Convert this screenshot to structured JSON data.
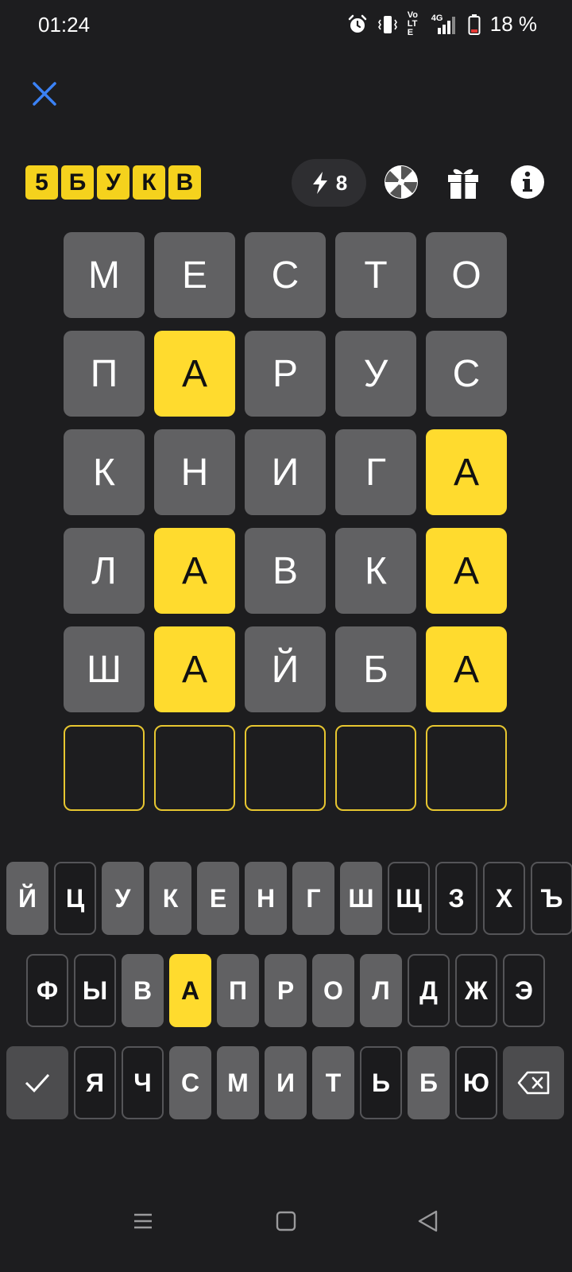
{
  "status_bar": {
    "time": "01:24",
    "battery": "18 %",
    "network": "4G",
    "volte": "Vo LTE",
    "icons": [
      "alarm-icon",
      "vibrate-icon",
      "volte-icon",
      "signal-icon",
      "battery-icon"
    ]
  },
  "header": {
    "logo_letters": [
      "5",
      "Б",
      "У",
      "К",
      "В"
    ],
    "energy_count": "8",
    "icons": [
      "close-icon",
      "bolt-icon",
      "wheel-icon",
      "gift-icon",
      "info-icon"
    ]
  },
  "board": {
    "rows": [
      [
        {
          "letter": "М",
          "state": "absent"
        },
        {
          "letter": "Е",
          "state": "absent"
        },
        {
          "letter": "С",
          "state": "absent"
        },
        {
          "letter": "Т",
          "state": "absent"
        },
        {
          "letter": "О",
          "state": "absent"
        }
      ],
      [
        {
          "letter": "П",
          "state": "absent"
        },
        {
          "letter": "А",
          "state": "present"
        },
        {
          "letter": "Р",
          "state": "absent"
        },
        {
          "letter": "У",
          "state": "absent"
        },
        {
          "letter": "С",
          "state": "absent"
        }
      ],
      [
        {
          "letter": "К",
          "state": "absent"
        },
        {
          "letter": "Н",
          "state": "absent"
        },
        {
          "letter": "И",
          "state": "absent"
        },
        {
          "letter": "Г",
          "state": "absent"
        },
        {
          "letter": "А",
          "state": "present"
        }
      ],
      [
        {
          "letter": "Л",
          "state": "absent"
        },
        {
          "letter": "А",
          "state": "present"
        },
        {
          "letter": "В",
          "state": "absent"
        },
        {
          "letter": "К",
          "state": "absent"
        },
        {
          "letter": "А",
          "state": "present"
        }
      ],
      [
        {
          "letter": "Ш",
          "state": "absent"
        },
        {
          "letter": "А",
          "state": "present"
        },
        {
          "letter": "Й",
          "state": "absent"
        },
        {
          "letter": "Б",
          "state": "absent"
        },
        {
          "letter": "А",
          "state": "present"
        }
      ],
      [
        {
          "letter": "",
          "state": "empty"
        },
        {
          "letter": "",
          "state": "empty"
        },
        {
          "letter": "",
          "state": "empty"
        },
        {
          "letter": "",
          "state": "empty"
        },
        {
          "letter": "",
          "state": "empty"
        }
      ]
    ]
  },
  "keyboard": {
    "row1": [
      {
        "key": "Й",
        "state": "absent"
      },
      {
        "key": "Ц",
        "state": "unused"
      },
      {
        "key": "У",
        "state": "absent"
      },
      {
        "key": "К",
        "state": "absent"
      },
      {
        "key": "Е",
        "state": "absent"
      },
      {
        "key": "Н",
        "state": "absent"
      },
      {
        "key": "Г",
        "state": "absent"
      },
      {
        "key": "Ш",
        "state": "absent"
      },
      {
        "key": "Щ",
        "state": "unused"
      },
      {
        "key": "З",
        "state": "unused"
      },
      {
        "key": "Х",
        "state": "unused"
      },
      {
        "key": "Ъ",
        "state": "unused"
      }
    ],
    "row2": [
      {
        "key": "Ф",
        "state": "unused"
      },
      {
        "key": "Ы",
        "state": "unused"
      },
      {
        "key": "В",
        "state": "absent"
      },
      {
        "key": "А",
        "state": "present"
      },
      {
        "key": "П",
        "state": "absent"
      },
      {
        "key": "Р",
        "state": "absent"
      },
      {
        "key": "О",
        "state": "absent"
      },
      {
        "key": "Л",
        "state": "absent"
      },
      {
        "key": "Д",
        "state": "unused"
      },
      {
        "key": "Ж",
        "state": "unused"
      },
      {
        "key": "Э",
        "state": "unused"
      }
    ],
    "row3": [
      {
        "key": "Я",
        "state": "unused"
      },
      {
        "key": "Ч",
        "state": "unused"
      },
      {
        "key": "С",
        "state": "absent"
      },
      {
        "key": "М",
        "state": "absent"
      },
      {
        "key": "И",
        "state": "absent"
      },
      {
        "key": "Т",
        "state": "absent"
      },
      {
        "key": "Ь",
        "state": "unused"
      },
      {
        "key": "Б",
        "state": "absent"
      },
      {
        "key": "Ю",
        "state": "unused"
      }
    ],
    "enter_icon": "checkmark-icon",
    "backspace_icon": "backspace-icon"
  },
  "nav_bar": {
    "icons": [
      "recents-icon",
      "home-icon",
      "back-icon"
    ]
  },
  "colors": {
    "background": "#1d1d1f",
    "absent": "#616163",
    "present": "#ffdb2e",
    "empty_border": "#e7c630",
    "accent_blue": "#3b82f6"
  }
}
